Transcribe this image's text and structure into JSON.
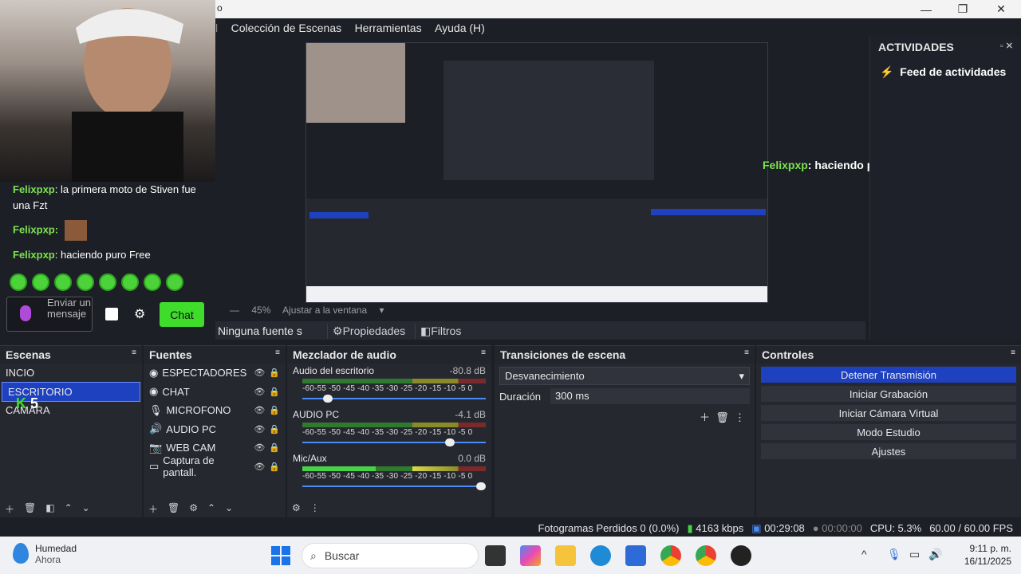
{
  "window": {
    "title_fragment": "o"
  },
  "menu": [
    "Colección de Escenas",
    "Herramientas",
    "Ayuda (H)"
  ],
  "preview": {
    "zoom": "45%",
    "fit_label": "Ajustar a la ventana"
  },
  "activities": {
    "title": "ACTIVIDADES",
    "feed": "Feed de actividades"
  },
  "overlay_chat": {
    "user": "Felixpxp",
    "text": ": haciendo puro Free"
  },
  "source_bar": {
    "none_label": "Ninguna fuente s",
    "properties": "Propiedades",
    "filters": "Filtros"
  },
  "chat": {
    "messages": [
      {
        "user": "Felixpxp",
        "text": ": la primera moto de Stiven fue una Fzt"
      },
      {
        "user": "Felixpxp",
        "text": ":"
      },
      {
        "user": "Felixpxp",
        "text": ": haciendo puro Free"
      }
    ],
    "input_placeholder": "Enviar un mensaje",
    "send_button": "Chat"
  },
  "scenes": {
    "title": "Escenas",
    "items": [
      "INCIO",
      "ESCRITORIO",
      "CAMARA"
    ],
    "selected": "ESCRITORIO",
    "badge": "5"
  },
  "sources": {
    "title": "Fuentes",
    "items": [
      "ESPECTADORES",
      "CHAT",
      "MICROFONO",
      "AUDIO PC",
      "WEB CAM",
      "Captura de pantall."
    ]
  },
  "mixer": {
    "title": "Mezclador de audio",
    "ticks": "-60-55 -50 -45 -40 -35 -30 -25 -20 -15 -10 -5 0",
    "channels": [
      {
        "name": "Audio del escritorio",
        "db": "-80.8 dB",
        "volume": 0.12
      },
      {
        "name": "AUDIO PC",
        "db": "-4.1 dB",
        "volume": 0.82
      },
      {
        "name": "Mic/Aux",
        "db": "0.0 dB",
        "volume": 1.0
      }
    ]
  },
  "transitions": {
    "title": "Transiciones de escena",
    "selected": "Desvanecimiento",
    "duration_label": "Duración",
    "duration_value": "300 ms"
  },
  "controls": {
    "title": "Controles",
    "buttons": [
      "Detener Transmisión",
      "Iniciar Grabación",
      "Iniciar Cámara Virtual",
      "Modo Estudio",
      "Ajustes"
    ]
  },
  "status": {
    "dropped": "Fotogramas Perdidos 0 (0.0%)",
    "bitrate": "4163 kbps",
    "stream_time": "00:29:08",
    "rec_time": "00:00:00",
    "cpu": "CPU: 5.3%",
    "fps": "60.00 / 60.00 FPS"
  },
  "taskbar": {
    "weather_title": "Humedad",
    "weather_sub": "Ahora",
    "search_placeholder": "Buscar",
    "time": "9:11 p. m.",
    "date": "16/11/2025"
  }
}
